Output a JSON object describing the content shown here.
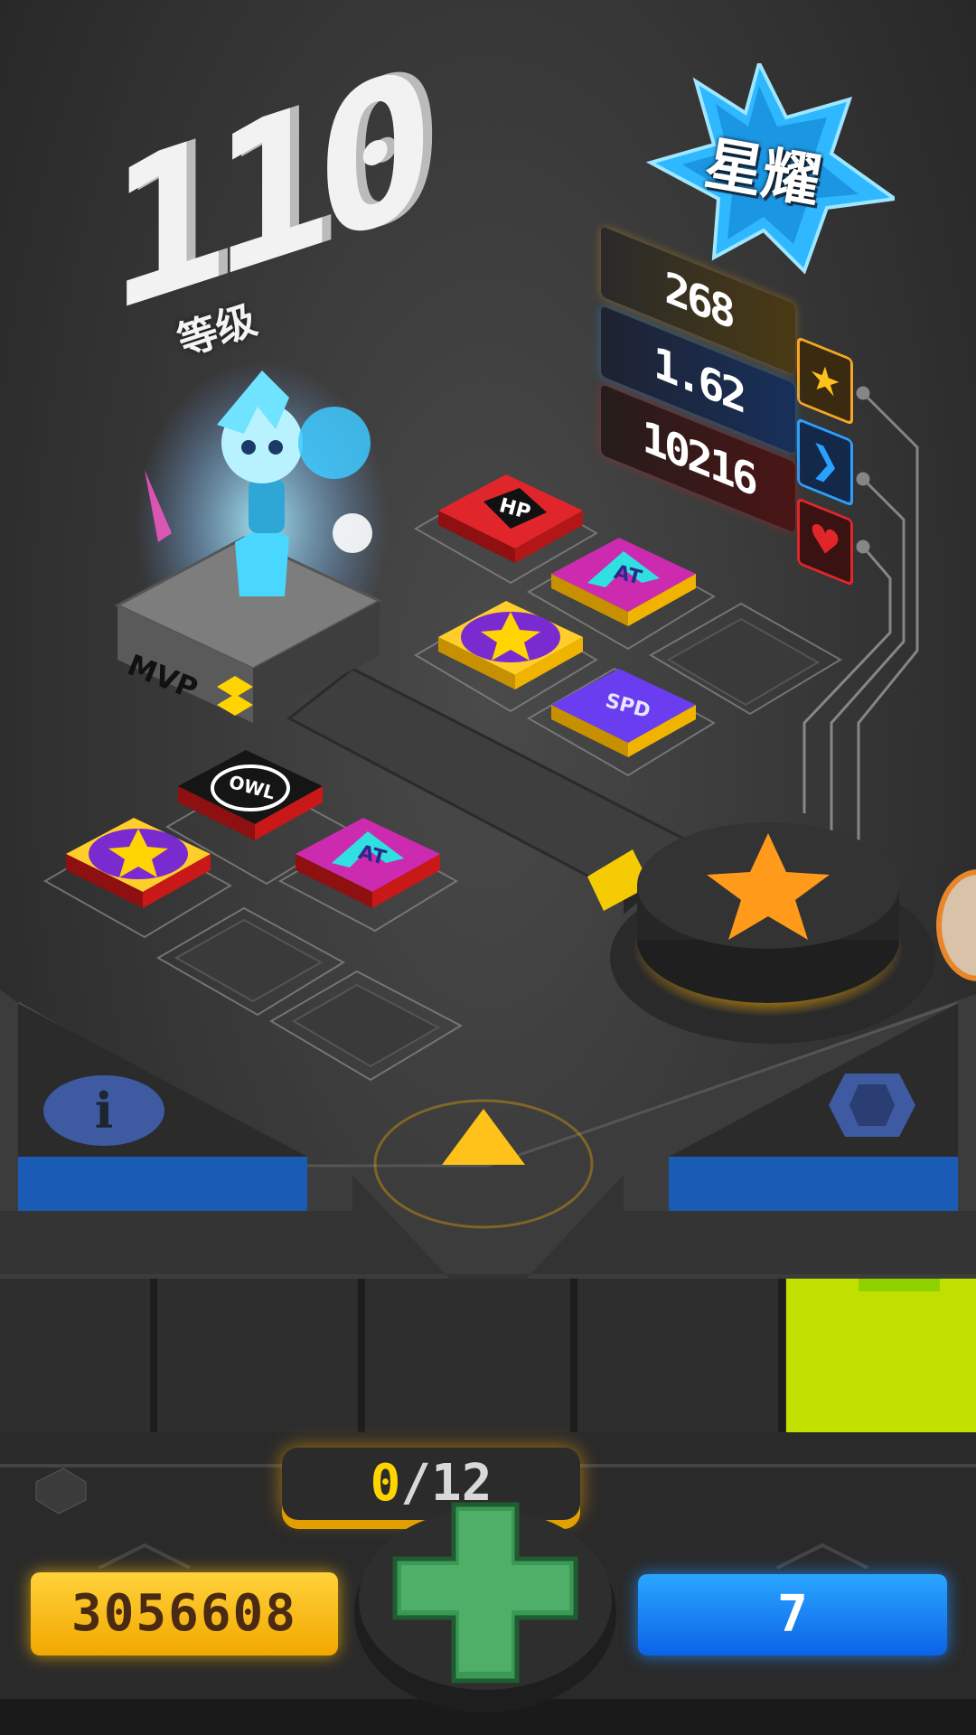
{
  "player": {
    "level": "110",
    "level_label": "等级"
  },
  "rank": {
    "label": "星耀",
    "badge_color": "#2fb8ff"
  },
  "stats": [
    {
      "value": "268",
      "icon": "star-icon",
      "color": "#f5a623"
    },
    {
      "value": "1.62",
      "icon": "chevron-right-icon",
      "color": "#2aa0ff"
    },
    {
      "value": "10216",
      "icon": "heart-icon",
      "color": "#e0262a"
    }
  ],
  "tiles": [
    {
      "label": "HP",
      "icon": "hp-icon",
      "color": "#e0262a"
    },
    {
      "label": "AT",
      "icon": "attack-up-icon",
      "color": "#cc2bb0"
    },
    {
      "label": "★",
      "icon": "star-icon",
      "color": "#ffce2a"
    },
    {
      "label": "SPD",
      "icon": "speed-icon",
      "color": "#6a3df0"
    },
    {
      "label": "OWL",
      "icon": "owl-icon",
      "color": "#111111"
    },
    {
      "label": "★",
      "icon": "star-icon",
      "color": "#ffce2a"
    },
    {
      "label": "AT",
      "icon": "attack-up-icon",
      "color": "#cc2bb0"
    }
  ],
  "pedestal": {
    "label": "MVP"
  },
  "hud": {
    "gold": "3056608",
    "gems": "7",
    "counter_current": "0",
    "counter_sep": "/",
    "counter_max": "12"
  },
  "colors": {
    "accent_yellow": "#ffc21a",
    "accent_blue": "#1a72e8",
    "lime_panel": "#c2e000"
  }
}
